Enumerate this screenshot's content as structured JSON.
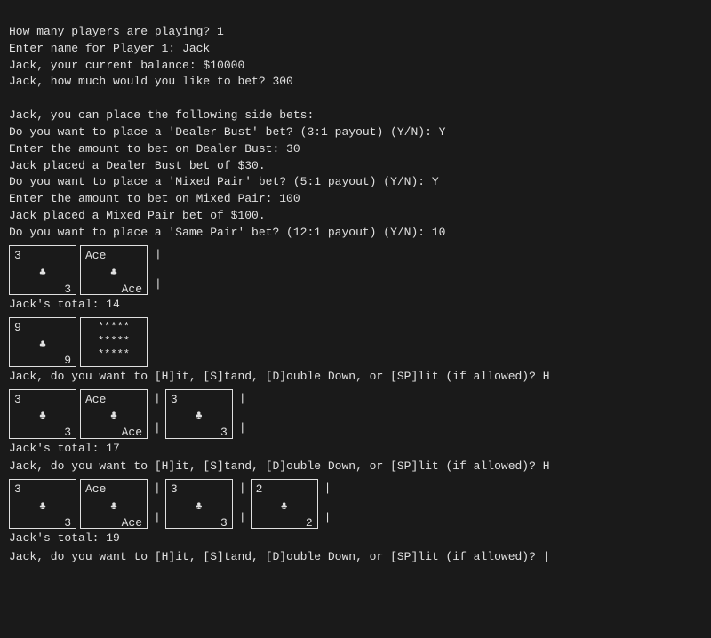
{
  "terminal": {
    "lines": [
      "How many players are playing? 1",
      "Enter name for Player 1: Jack",
      "Jack, your current balance: $10000",
      "Jack, how much would you like to bet? 300",
      "",
      "Jack, you can place the following side bets:",
      "Do you want to place a 'Dealer Bust' bet? (3:1 payout) (Y/N): Y",
      "Enter the amount to bet on Dealer Bust: 30",
      "Jack placed a Dealer Bust bet of $30.",
      "Do you want to place a 'Mixed Pair' bet? (5:1 payout) (Y/N): Y",
      "Enter the amount to bet on Mixed Pair: 100",
      "Jack placed a Mixed Pair bet of $100.",
      "Do you want to place a 'Same Pair' bet? (12:1 payout) (Y/N): 10"
    ],
    "jack_total_14": "Jack's total: 14",
    "jack_total_17": "Jack's total: 17",
    "jack_total_19": "Jack's total: 19",
    "prompt_1": "Jack, do you want to [H]it, [S]tand, [D]ouble Down, or [SP]lit (if allowed)? H",
    "prompt_2": "Jack, do you want to [H]it, [S]tand, [D]ouble Down, or [SP]lit (if allowed)? H",
    "prompt_3": "Jack, do you want to [H]it, [S]tand, [D]ouble Down, or [SP]lit (if allowed)? |"
  }
}
